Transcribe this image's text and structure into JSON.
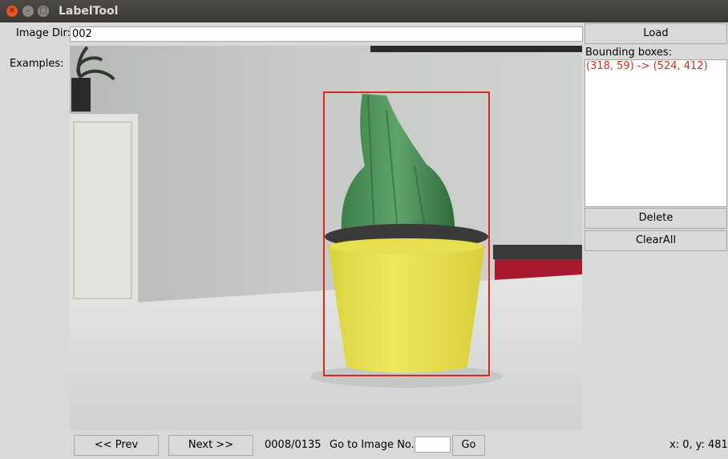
{
  "window": {
    "title": "LabelTool",
    "controls": [
      "close-icon",
      "minimize-icon",
      "maximize-icon"
    ]
  },
  "top": {
    "image_dir_label": "Image Dir:",
    "image_dir_value": "002",
    "load_label": "Load"
  },
  "left": {
    "examples_label": "Examples:"
  },
  "right": {
    "bbox_header": "Bounding boxes:",
    "bboxes": [
      "(318, 59) -> (524, 412)"
    ],
    "delete_label": "Delete",
    "clear_all_label": "ClearAll"
  },
  "bottom": {
    "prev_label": "<< Prev",
    "next_label": "Next >>",
    "progress": "0008/0135",
    "goto_label": "Go to Image No.",
    "goto_value": "",
    "go_label": "Go",
    "coords": "x: 0, y: 481"
  },
  "colors": {
    "bbox_outline": "#d62a1e",
    "titlebar": "#3c3b37",
    "window_bg": "#d9d9d9"
  }
}
